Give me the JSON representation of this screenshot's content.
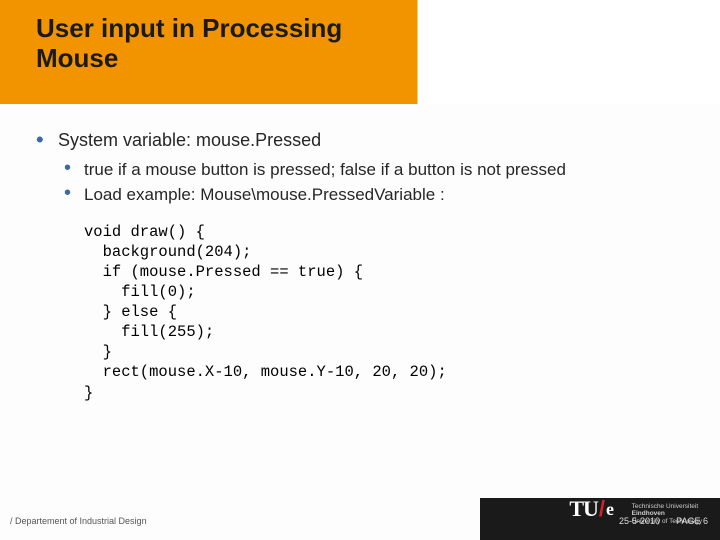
{
  "title": {
    "line1": "User input in Processing",
    "line2": "Mouse"
  },
  "bullets": {
    "main": "System variable: mouse.Pressed",
    "sub1": "true if a mouse button is pressed; false if a button is not pressed",
    "sub2": "Load example: Mouse\\mouse.PressedVariable :"
  },
  "code": "void draw() {\n  background(204);\n  if (mouse.Pressed == true) {\n    fill(0);\n  } else {\n    fill(255);\n  }\n  rect(mouse.X-10, mouse.Y-10, 20, 20);\n}",
  "footer": {
    "dept": "/ Departement of Industrial Design",
    "date": "25-5-2010",
    "page": "PAGE 6",
    "uni1": "Technische Universiteit",
    "uni2": "Eindhoven",
    "uni3": "University of Technology"
  }
}
